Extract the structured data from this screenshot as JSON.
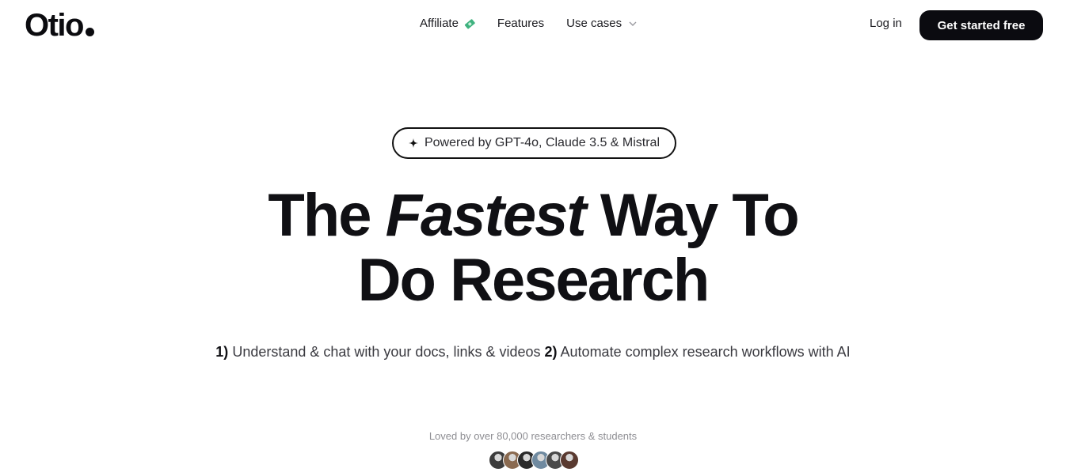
{
  "brand": {
    "logo": "Otio"
  },
  "nav": {
    "items": [
      {
        "label": "Affiliate",
        "icon": "money-icon"
      },
      {
        "label": "Features"
      },
      {
        "label": "Use cases",
        "icon": "chevron-down-icon"
      }
    ],
    "login": "Log in",
    "cta": "Get started free"
  },
  "hero": {
    "badge": "Powered by GPT-4o, Claude 3.5 & Mistral",
    "headline_pre": "The ",
    "headline_em": "Fastest",
    "headline_post": " Way To",
    "headline_line2": "Do Research",
    "sub": {
      "n1": "1)",
      "t1": " Understand & chat with your docs, links & videos ",
      "n2": "2)",
      "t2": " Automate complex research workflows with AI"
    },
    "social_proof": "Loved by over 80,000 researchers & students",
    "avatar_colors": [
      "#3c3c3c",
      "#8a6a50",
      "#2a2a2a",
      "#6f8aa0",
      "#4a4a4a",
      "#5a3a30"
    ]
  }
}
